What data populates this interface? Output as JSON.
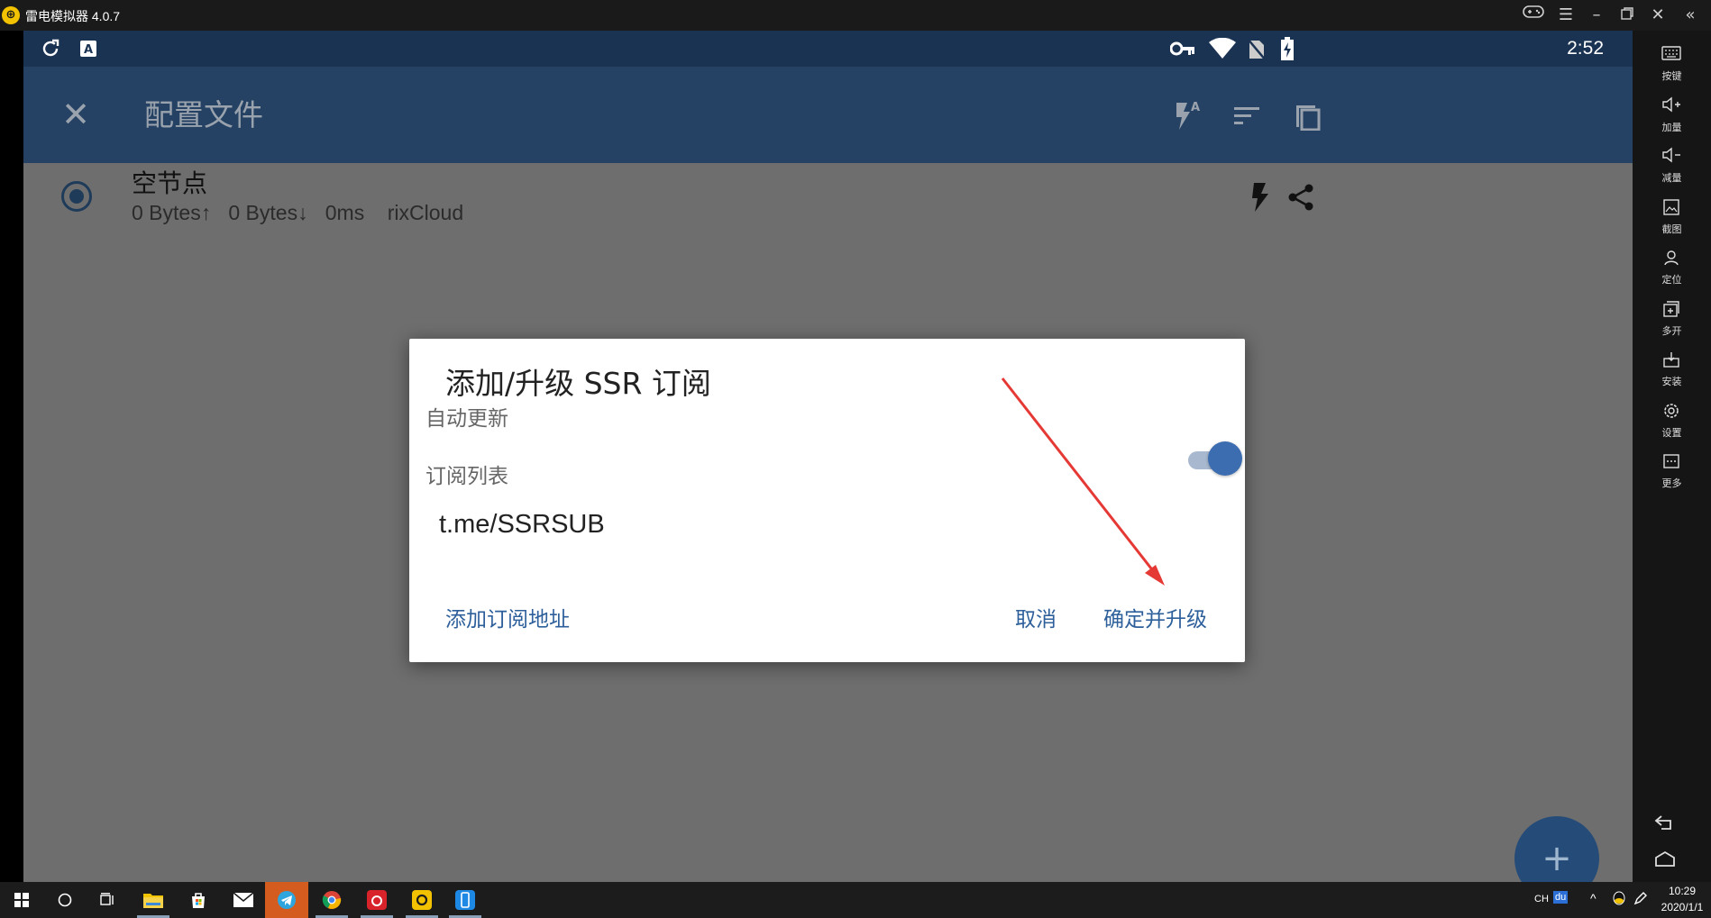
{
  "emulator": {
    "title": "雷电模拟器 4.0.7",
    "sidebar": [
      {
        "label": "按键",
        "icon": "keyboard-icon"
      },
      {
        "label": "加量",
        "icon": "volume-up-icon"
      },
      {
        "label": "减量",
        "icon": "volume-down-icon"
      },
      {
        "label": "截图",
        "icon": "screenshot-icon"
      },
      {
        "label": "定位",
        "icon": "location-icon"
      },
      {
        "label": "多开",
        "icon": "multi-instance-icon"
      },
      {
        "label": "安装",
        "icon": "install-icon"
      },
      {
        "label": "设置",
        "icon": "settings-icon"
      },
      {
        "label": "更多",
        "icon": "more-icon"
      }
    ]
  },
  "statusbar": {
    "time": "2:52"
  },
  "appbar": {
    "title": "配置文件"
  },
  "node": {
    "name": "空节点",
    "stats": "0 Bytes↑   0 Bytes↓   0ms    rixCloud"
  },
  "dialog": {
    "title": "添加/升级 SSR 订阅",
    "auto_update_label": "自动更新",
    "auto_update_on": true,
    "subscription_list_label": "订阅列表",
    "subscription_value": "t.me/SSRSUB",
    "add_button": "添加订阅地址",
    "cancel_button": "取消",
    "confirm_button": "确定并升级"
  },
  "fab": {
    "label": "+"
  },
  "taskbar": {
    "lang": "CH",
    "ime": "du",
    "time": "10:29",
    "date": "2020/1/1"
  },
  "colors": {
    "statusbar": "#1b3353",
    "appbar": "#254264",
    "accent": "#2d5f9b",
    "switch_thumb": "#3c6db0",
    "annotation_arrow": "#e53935"
  }
}
